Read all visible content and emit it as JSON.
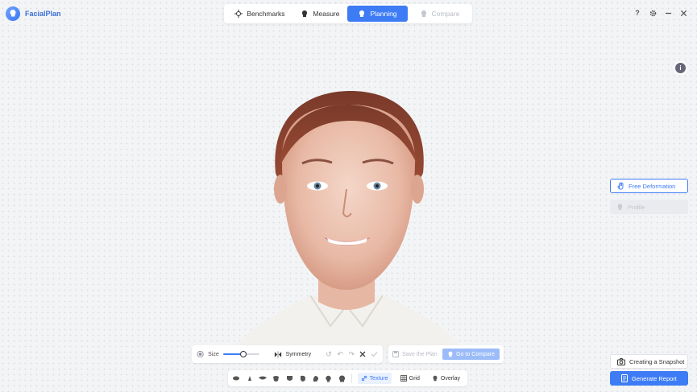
{
  "app": {
    "name": "FacialPlan"
  },
  "nav": {
    "tabs": [
      {
        "label": "Benchmarks",
        "state": "normal"
      },
      {
        "label": "Measure",
        "state": "normal"
      },
      {
        "label": "Planning",
        "state": "active"
      },
      {
        "label": "Compare",
        "state": "disabled"
      }
    ]
  },
  "window": {
    "help": "?",
    "settings_icon": "gear-icon",
    "minimize_icon": "minimize-icon",
    "close_icon": "close-icon"
  },
  "side_panel": {
    "free_deformation": "Free Deformation",
    "profile": "Profile"
  },
  "brush": {
    "size_label": "Size",
    "size_value": 0.5,
    "symmetry_label": "Symmetry"
  },
  "plan": {
    "save_label": "Save the Plan",
    "goto_label": "Go to Compare"
  },
  "view": {
    "texture_label": "Texture",
    "grid_label": "Grid",
    "overlay_label": "Overlay"
  },
  "actions": {
    "snapshot_label": "Creating a Snapshot",
    "report_label": "Generate Report"
  },
  "colors": {
    "accent": "#3d7cf5",
    "background": "#f3f4f6"
  }
}
